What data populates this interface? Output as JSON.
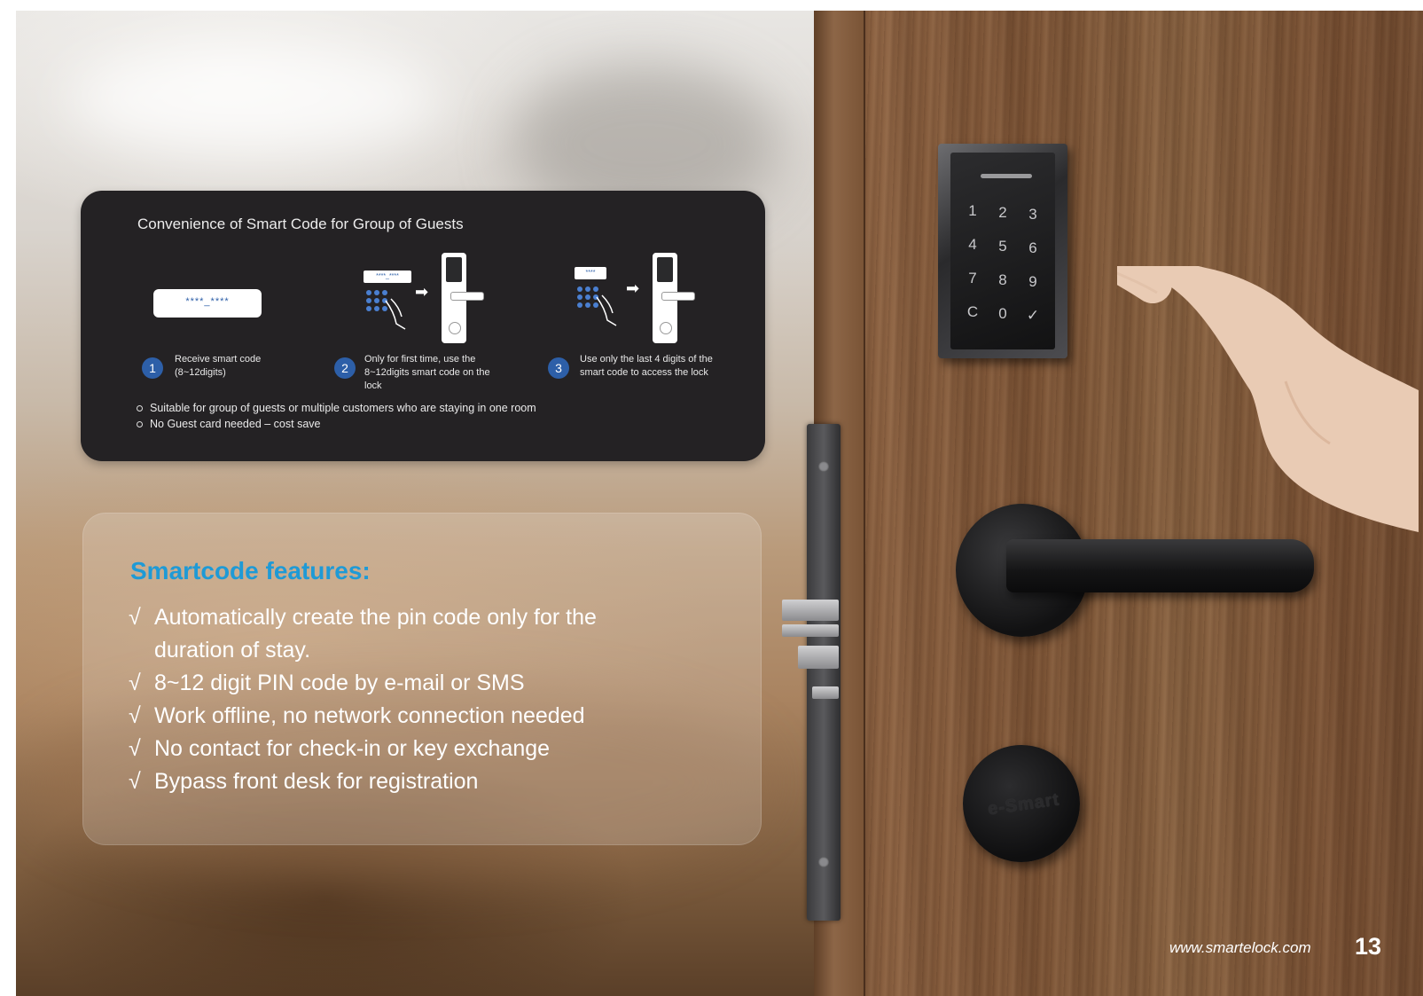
{
  "panel": {
    "title": "Convenience of Smart Code for Group of Guests",
    "steps": [
      {
        "num": "1",
        "text": "Receive smart code (8~12digits)",
        "code": "****_****"
      },
      {
        "num": "2",
        "text": "Only for first time, use the 8~12digits smart code on the lock",
        "code": "****_****"
      },
      {
        "num": "3",
        "text": "Use only the last 4 digits of the smart code to access the lock",
        "code": "****"
      }
    ],
    "bullets": [
      "Suitable for group of guests or multiple customers who are staying in one room",
      "No Guest card needed – cost save"
    ]
  },
  "features": {
    "title": "Smartcode features:",
    "tick": "√",
    "items": [
      "Automatically create the pin code only for the duration of stay.",
      "8~12 digit PIN code by e-mail or SMS",
      "Work offline, no network connection needed",
      "No contact for check-in or key exchange",
      "Bypass front desk for registration"
    ]
  },
  "photo": {
    "keypad_keys": [
      "1",
      "2",
      "3",
      "4",
      "5",
      "6",
      "7",
      "8",
      "9",
      "C",
      "0",
      "✓"
    ],
    "deadbolt_brand": "e-Smart"
  },
  "footer": {
    "url": "www.smartelock.com",
    "page": "13"
  }
}
